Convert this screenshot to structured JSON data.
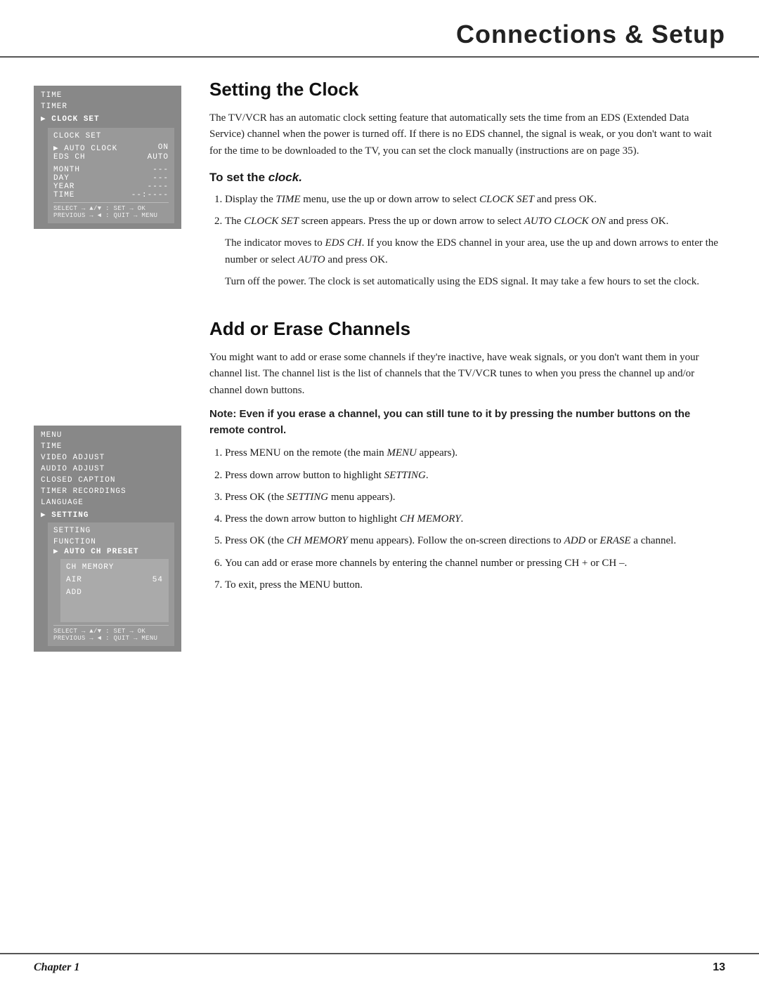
{
  "header": {
    "title": "Connections & Setup"
  },
  "section1": {
    "title": "Setting the Clock",
    "intro": "The TV/VCR has an automatic clock setting feature that automatically sets the time from an EDS (Extended Data Service) channel when the power is turned off. If there is no EDS channel, the signal is weak, or you don't want to wait for the time to be downloaded to the TV, you can set the clock manually (instructions are on page 35).",
    "subsection_title": "To set the clock.",
    "steps": [
      "Display the TIME menu, use the up or down arrow to select CLOCK SET and press OK.",
      "The CLOCK SET screen appears. Press the up or down arrow to select AUTO CLOCK ON and press OK.",
      "The indicator moves to EDS CH. If you know the EDS channel in your area, use the up and down arrows to enter the number or select AUTO and press OK.",
      "Turn off the power. The clock is set automatically using the EDS signal. It may take a few hours to set the clock."
    ],
    "clock_menu": {
      "time_label": "TIME",
      "timer_label": "TIMER",
      "clock_set_label": "▶ CLOCK SET",
      "inner_title": "CLOCK SET",
      "auto_clock": "▶ AUTO CLOCK",
      "auto_clock_val": "ON",
      "eds_ch": "EDS CH",
      "eds_ch_val": "AUTO",
      "month": "MONTH",
      "month_val": "---",
      "day": "DAY",
      "day_val": "---",
      "year": "YEAR",
      "year_val": "----",
      "time_field": "TIME",
      "time_val": "--:----",
      "bottom": "SELECT  → ▲/▼ : SET → OK\nPREVIOUS → ◄  : QUIT → MENU"
    }
  },
  "section2": {
    "title": "Add or Erase Channels",
    "intro": "You might want to add or erase some channels if they're inactive, have weak signals, or you don't want them in your channel list. The channel list is the list of channels that the TV/VCR tunes to when you press the channel up and/or channel down buttons.",
    "note": "Note: Even if you erase a channel, you can still tune to it by pressing the number buttons on the remote control.",
    "steps": [
      "Press MENU on the remote (the main MENU appears).",
      "Press down arrow button to highlight SETTING.",
      "Press OK (the SETTING menu appears).",
      "Press the down arrow button to highlight CH MEMORY.",
      "Press OK (the CH MEMORY menu appears). Follow the on-screen directions to ADD or ERASE a channel.",
      "You can add or erase more channels by entering the channel number or pressing CH + or CH –.",
      "To exit, press the MENU button."
    ],
    "channel_menu": {
      "menu_label": "MENU",
      "time_label": "TIME",
      "video_adjust": "VIDEO ADJUST",
      "audio_adjust": "AUDIO ADJUST",
      "closed_caption": "CLOSED CAPTION",
      "timer_recordings": "TIMER RECORDINGS",
      "language": "LANGUAGE",
      "setting": "▶ SETTING",
      "setting_inner": "SETTING",
      "function_label": "FUNCTION",
      "auto_ch_preset": "▶ AUTO CH PRESET",
      "ch_memory": "CH MEMORY",
      "air_label": "AIR",
      "air_val": "54",
      "add_label": "ADD",
      "bottom": "SELECT  → ▲/▼ : SET → OK\nPREVIOUS → ◄  : QUIT → MENU"
    }
  },
  "footer": {
    "chapter": "Chapter 1",
    "page": "13"
  }
}
